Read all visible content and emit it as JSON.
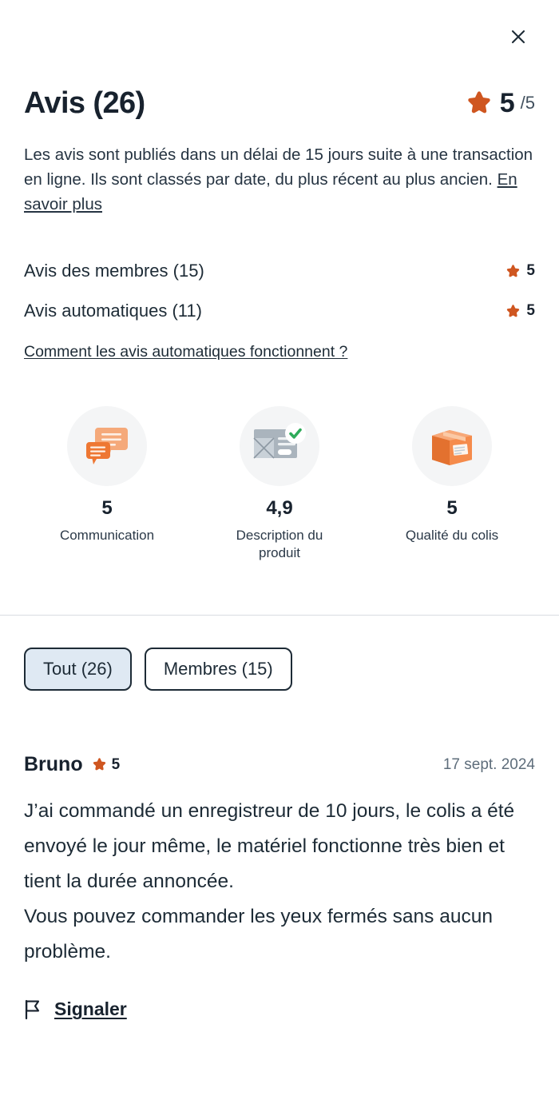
{
  "colors": {
    "star": "#cf5620",
    "accent_orange": "#ef7d3e",
    "check_green": "#2eab5a",
    "chip_selected_bg": "#dfe9f3",
    "text": "#1d2b36",
    "muted": "#5e6d7b",
    "divider": "#d9dde1",
    "circle_bg": "#f4f5f6"
  },
  "header": {
    "close_icon": "close-icon",
    "title": "Avis (26)",
    "overall_score": "5",
    "overall_outof": "/5",
    "overall_star_icon": "star-icon"
  },
  "intro": {
    "text": "Les avis sont publiés dans un délai de 15 jours suite à une transaction en ligne. Ils sont classés par date, du plus récent au plus ancien. ",
    "link": "En savoir plus"
  },
  "breakdown": {
    "rows": [
      {
        "label": "Avis des membres (15)",
        "score": "5",
        "star_icon": "star-icon"
      },
      {
        "label": "Avis automatiques (11)",
        "score": "5",
        "star_icon": "star-icon"
      }
    ],
    "link": "Comment les avis automatiques fonctionnent ?"
  },
  "criteria": [
    {
      "icon": "speech-bubbles-icon",
      "score": "5",
      "label": "Communication"
    },
    {
      "icon": "product-description-check-icon",
      "score": "4,9",
      "label": "Description du produit"
    },
    {
      "icon": "package-box-icon",
      "score": "5",
      "label": "Qualité du colis"
    }
  ],
  "filters": [
    {
      "label": "Tout (26)",
      "selected": true
    },
    {
      "label": "Membres (15)",
      "selected": false
    }
  ],
  "review": {
    "author": "Bruno",
    "rating": "5",
    "star_icon": "star-icon",
    "date": "17 sept. 2024",
    "body": "J’ai commandé un enregistreur de 10 jours, le colis a été envoyé le jour même, le matériel fonctionne très bien et tient la durée annoncée.\nVous pouvez commander les yeux fermés sans aucun problème.",
    "report_label": "Signaler",
    "report_icon": "flag-icon"
  }
}
